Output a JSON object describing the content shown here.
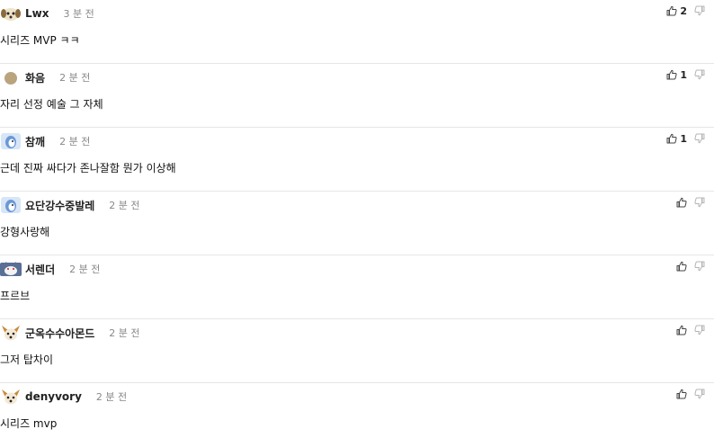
{
  "comments": [
    {
      "nick": "Lwx",
      "time": "3 분 전",
      "text": "시리즈 MVP ㅋㅋ",
      "likes": "2",
      "avatar": "puppy-avatar-icon"
    },
    {
      "nick": "화음",
      "time": "2 분 전",
      "text": "자리 선정 예술 그 자체",
      "likes": "1",
      "avatar": "tan-circle-avatar-icon"
    },
    {
      "nick": "참깨",
      "time": "2 분 전",
      "text": "근데 진짜 싸다가 존나잘함 뭔가 이상해",
      "likes": "1",
      "avatar": "blue-face-avatar-icon"
    },
    {
      "nick": "요단강수중발레",
      "time": "2 분 전",
      "text": "강형사랑해",
      "likes": "",
      "avatar": "blue-face-avatar-icon"
    },
    {
      "nick": "서렌더",
      "time": "2 분 전",
      "text": "프르브",
      "likes": "",
      "avatar": "wolf-avatar-icon"
    },
    {
      "nick": "군옥수수아몬드",
      "time": "2 분 전",
      "text": "그저 탑차이",
      "likes": "",
      "avatar": "chihuahua-avatar-icon"
    },
    {
      "nick": "denyvory",
      "time": "2 분 전",
      "text": "시리즈 mvp",
      "likes": "",
      "avatar": "chihuahua-avatar-icon"
    }
  ]
}
